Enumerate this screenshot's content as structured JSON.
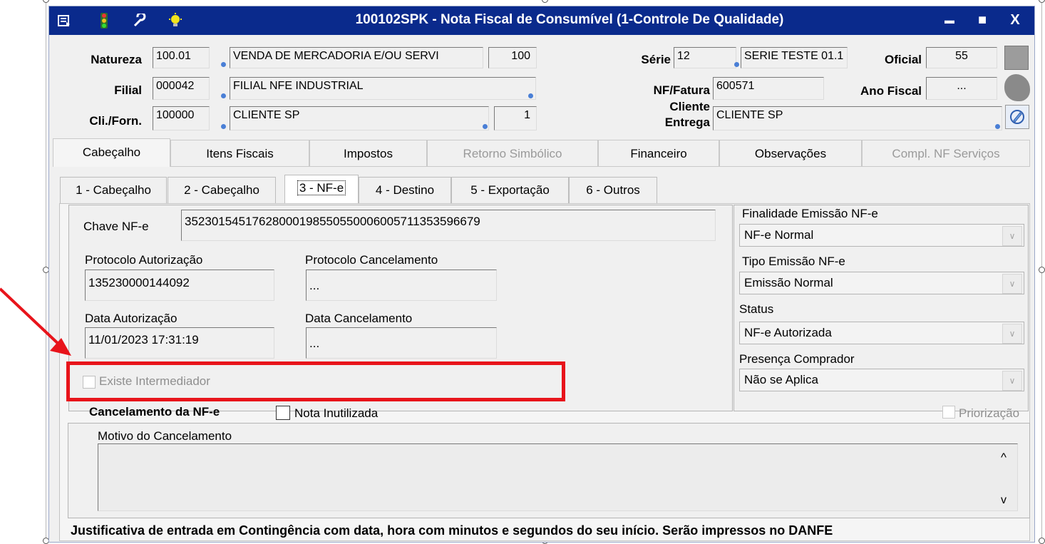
{
  "window": {
    "title": "100102SPK - Nota Fiscal de Consumível (1-Controle De Qualidade)",
    "minimize": "▬",
    "maximize": "■",
    "close": "X"
  },
  "toolbar_icons": [
    "list-icon",
    "traffic-light-icon",
    "wrench-icon",
    "lightbulb-icon"
  ],
  "header": {
    "natureza": {
      "label": "Natureza",
      "code": "100.01",
      "desc": "VENDA DE MERCADORIA E/OU SERVI",
      "num": "100"
    },
    "filial": {
      "label": "Filial",
      "code": "000042",
      "desc": "FILIAL NFE INDUSTRIAL"
    },
    "cliforn": {
      "label": "Cli./Forn.",
      "code": "100000",
      "desc": "CLIENTE SP",
      "num": "1"
    },
    "serie": {
      "label": "Série",
      "code": "12",
      "desc": "SERIE TESTE 01.1"
    },
    "oficial": {
      "label": "Oficial",
      "value": "55"
    },
    "nf_fatura": {
      "label": "NF/Fatura",
      "value": "600571"
    },
    "ano_fiscal": {
      "label": "Ano Fiscal",
      "value": "..."
    },
    "cliente_entrega": {
      "label_line1": "Cliente",
      "label_line2": "Entrega",
      "value": "CLIENTE SP"
    }
  },
  "main_tabs": [
    {
      "label": "Cabeçalho",
      "active": true,
      "enabled": true
    },
    {
      "label": "Itens Fiscais",
      "active": false,
      "enabled": true
    },
    {
      "label": "Impostos",
      "active": false,
      "enabled": true
    },
    {
      "label": "Retorno Simbólico",
      "active": false,
      "enabled": false
    },
    {
      "label": "Financeiro",
      "active": false,
      "enabled": true
    },
    {
      "label": "Observações",
      "active": false,
      "enabled": true
    },
    {
      "label": "Compl. NF Serviços",
      "active": false,
      "enabled": false
    }
  ],
  "sub_tabs": [
    "1 - Cabeçalho",
    "2 - Cabeçalho",
    "3 - NF-e",
    "4 - Destino",
    "5 - Exportação",
    "6 - Outros"
  ],
  "nfe": {
    "chave_label": "Chave NF-e",
    "chave_value": "35230154517628000198550550006005711353596679",
    "protocolo_aut_label": "Protocolo Autorização",
    "protocolo_aut_value": "135230000144092",
    "protocolo_canc_label": "Protocolo Cancelamento",
    "protocolo_canc_value": "...",
    "data_aut_label": "Data Autorização",
    "data_aut_value": "11/01/2023 17:31:19",
    "data_canc_label": "Data Cancelamento",
    "data_canc_value": "...",
    "intermediador_label": "Existe Intermediador"
  },
  "side": {
    "finalidade_label": "Finalidade Emissão NF-e",
    "finalidade_value": "NF-e Normal",
    "tipo_label": "Tipo Emissão NF-e",
    "tipo_value": "Emissão Normal",
    "status_label": "Status",
    "status_value": "NF-e Autorizada",
    "presenca_label": "Presença Comprador",
    "presenca_value": "Não se Aplica"
  },
  "cancel": {
    "title": "Cancelamento da NF-e",
    "inutilizada_label": "Nota Inutilizada",
    "priorizacao_label": "Priorização",
    "motivo_label": "Motivo do Cancelamento",
    "scroll_up": "^",
    "scroll_down": "v"
  },
  "footer": {
    "justificativa": "Justificativa de entrada em Contingência com data, hora com minutos e segundos do seu início. Serão impressos no DANFE"
  },
  "colors": {
    "titlebar": "#0a2a8c",
    "highlight_box": "#e8141b",
    "arrow": "#e8141b"
  }
}
